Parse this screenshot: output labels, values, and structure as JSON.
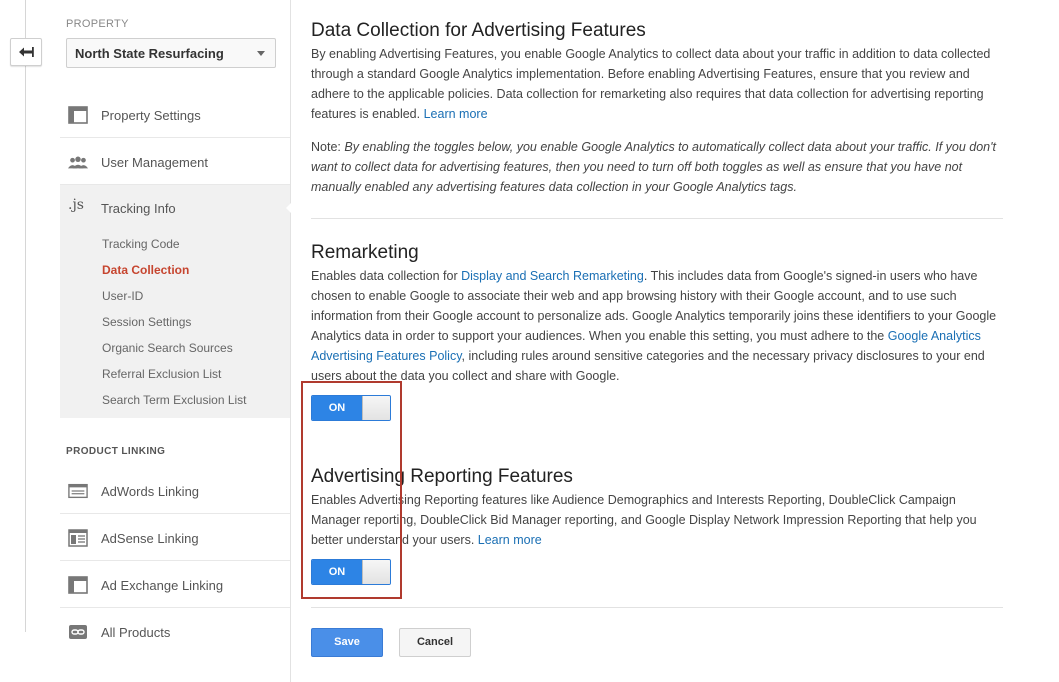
{
  "sidebar": {
    "property_label": "PROPERTY",
    "property_value": "North State Resurfacing",
    "items": [
      {
        "label": "Property Settings"
      },
      {
        "label": "User Management"
      }
    ],
    "tracking": {
      "icon_text": ".js",
      "label": "Tracking Info",
      "subitems": [
        {
          "label": "Tracking Code"
        },
        {
          "label": "Data Collection"
        },
        {
          "label": "User-ID"
        },
        {
          "label": "Session Settings"
        },
        {
          "label": "Organic Search Sources"
        },
        {
          "label": "Referral Exclusion List"
        },
        {
          "label": "Search Term Exclusion List"
        }
      ]
    },
    "product_linking_label": "PRODUCT LINKING",
    "linking": [
      {
        "label": "AdWords Linking"
      },
      {
        "label": "AdSense Linking"
      },
      {
        "label": "Ad Exchange Linking"
      },
      {
        "label": "All Products"
      }
    ]
  },
  "main": {
    "dc_title": "Data Collection for Advertising Features",
    "dc_body": "By enabling Advertising Features, you enable Google Analytics to collect data about your traffic in addition to data collected through a standard Google Analytics implementation. Before enabling Advertising Features, ensure that you review and adhere to the applicable policies. Data collection for remarketing also requires that data collection for advertising reporting features is enabled.",
    "learn_more": "Learn more",
    "note_label": "Note:",
    "note_text": "By enabling the toggles below, you enable Google Analytics to automatically collect data about your traffic. If you don't want to collect data for advertising features, then you need to turn off both toggles as well as ensure that you have not manually enabled any advertising features data collection in your Google Analytics tags.",
    "remarketing_title": "Remarketing",
    "rm_text1": "Enables data collection for",
    "rm_link1": "Display and Search Remarketing",
    "rm_text2": ". This includes data from Google's signed-in users who have chosen to enable Google to associate their web and app browsing history with their Google account, and to use such information from their Google account to personalize ads. Google Analytics temporarily joins these identifiers to your Google Analytics data in order to support your audiences. When you enable this setting, you must adhere to the",
    "rm_link2": "Google Analytics Advertising Features Policy",
    "rm_text3": ", including rules around sensitive categories and the necessary privacy disclosures to your end users about the data you collect and share with Google.",
    "toggle_on": "ON",
    "arf_title": "Advertising Reporting Features",
    "arf_body": "Enables Advertising Reporting features like Audience Demographics and Interests Reporting, DoubleClick Campaign Manager reporting, DoubleClick Bid Manager reporting, and Google Display Network Impression Reporting that help you better understand your users.",
    "save": "Save",
    "cancel": "Cancel"
  },
  "colors": {
    "accent": "#2d84e5",
    "active_nav": "#c6452f",
    "link": "#1a6fb4",
    "highlight_box": "#b03a2e"
  }
}
